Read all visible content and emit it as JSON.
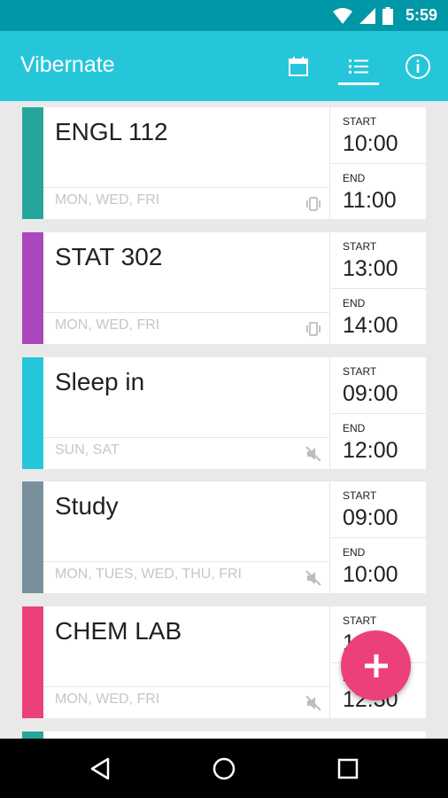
{
  "status_bar": {
    "time": "5:59"
  },
  "app_bar": {
    "title": "Vibernate",
    "actions": [
      {
        "icon": "calendar-icon"
      },
      {
        "icon": "list-icon",
        "selected": true
      },
      {
        "icon": "info-icon"
      }
    ]
  },
  "schedules": [
    {
      "name": "ENGL 112",
      "days": "MON, WED, FRI",
      "mode": "vibrate",
      "start_label": "START",
      "start": "10:00",
      "end_label": "END",
      "end": "11:00",
      "color": "#26a69a"
    },
    {
      "name": "STAT 302",
      "days": "MON, WED, FRI",
      "mode": "vibrate",
      "start_label": "START",
      "start": "13:00",
      "end_label": "END",
      "end": "14:00",
      "color": "#ab47bc"
    },
    {
      "name": "Sleep in",
      "days": "SUN, SAT",
      "mode": "silent",
      "start_label": "START",
      "start": "09:00",
      "end_label": "END",
      "end": "12:00",
      "color": "#26c6da"
    },
    {
      "name": "Study",
      "days": "MON, TUES, WED, THU, FRI",
      "mode": "silent",
      "start_label": "START",
      "start": "09:00",
      "end_label": "END",
      "end": "10:00",
      "color": "#78909c"
    },
    {
      "name": "CHEM LAB",
      "days": "MON, WED, FRI",
      "mode": "silent",
      "start_label": "START",
      "start": "1",
      "end_label": "E",
      "end": "12:30",
      "color": "#ec407a"
    }
  ],
  "fab": {
    "icon": "plus-icon",
    "color": "#ec407a"
  },
  "nav_bar": {
    "buttons": [
      "back-icon",
      "home-icon",
      "recents-icon"
    ]
  }
}
